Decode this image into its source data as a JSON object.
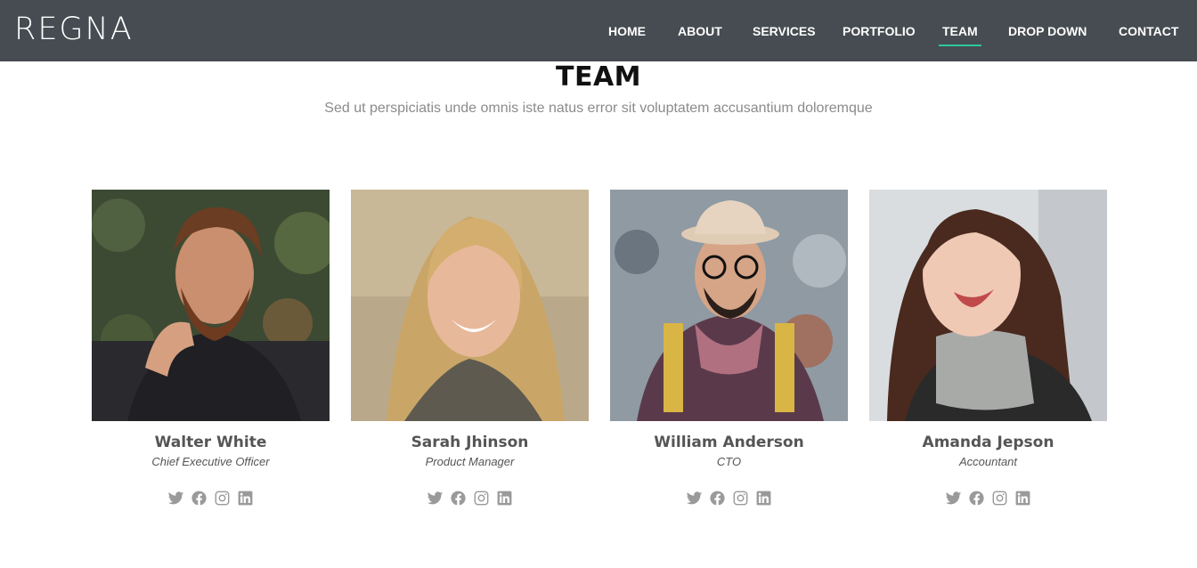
{
  "brand": {
    "logo": "REGNA",
    "accent": "#2dc997",
    "header_bg": "#464c51"
  },
  "nav": [
    {
      "label": "HOME",
      "active": false
    },
    {
      "label": "ABOUT",
      "active": false
    },
    {
      "label": "SERVICES",
      "active": false
    },
    {
      "label": "PORTFOLIO",
      "active": false
    },
    {
      "label": "TEAM",
      "active": true
    },
    {
      "label": "DROP DOWN",
      "active": false
    },
    {
      "label": "CONTACT",
      "active": false
    }
  ],
  "section": {
    "title": "TEAM",
    "subtitle": "Sed ut perspiciatis unde omnis iste natus error sit voluptatem accusantium doloremque"
  },
  "team": [
    {
      "name": "Walter White",
      "role": "Chief Executive Officer",
      "social": [
        "twitter-icon",
        "facebook-icon",
        "instagram-icon",
        "linkedin-icon"
      ]
    },
    {
      "name": "Sarah Jhinson",
      "role": "Product Manager",
      "social": [
        "twitter-icon",
        "facebook-icon",
        "instagram-icon",
        "linkedin-icon"
      ]
    },
    {
      "name": "William Anderson",
      "role": "CTO",
      "social": [
        "twitter-icon",
        "facebook-icon",
        "instagram-icon",
        "linkedin-icon"
      ]
    },
    {
      "name": "Amanda Jepson",
      "role": "Accountant",
      "social": [
        "twitter-icon",
        "facebook-icon",
        "instagram-icon",
        "linkedin-icon"
      ]
    }
  ]
}
